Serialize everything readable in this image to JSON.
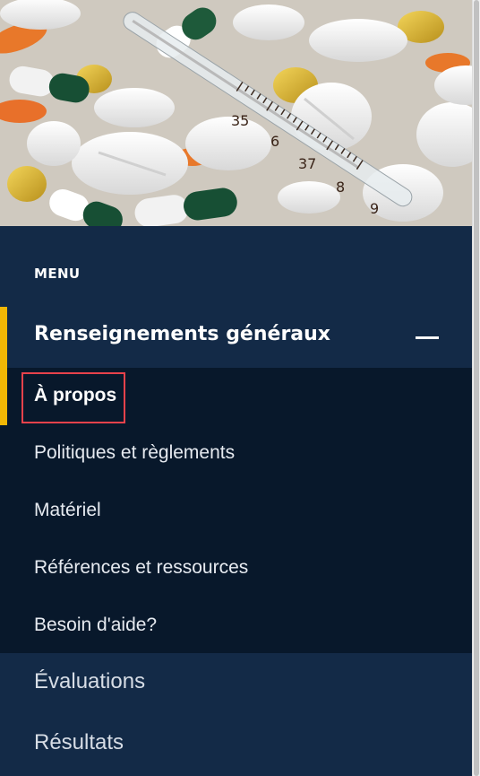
{
  "menu": {
    "heading": "MENU",
    "open_section": {
      "title": "Renseignements généraux",
      "toggle_icon": "minus-icon",
      "items": [
        {
          "label": "À propos",
          "active": true
        },
        {
          "label": "Politiques et règlements"
        },
        {
          "label": "Matériel"
        },
        {
          "label": "Références et ressources"
        },
        {
          "label": "Besoin d'aide?"
        }
      ]
    },
    "closed_sections": [
      {
        "label": "Évaluations"
      },
      {
        "label": "Résultats"
      }
    ]
  },
  "hero": {
    "thermometer_marks": [
      "35",
      "6",
      "37",
      "8",
      "9"
    ]
  },
  "colors": {
    "background": "#132a47",
    "submenu_background": "#08182b",
    "accent": "#f2b705",
    "highlight": "#e8424b"
  }
}
